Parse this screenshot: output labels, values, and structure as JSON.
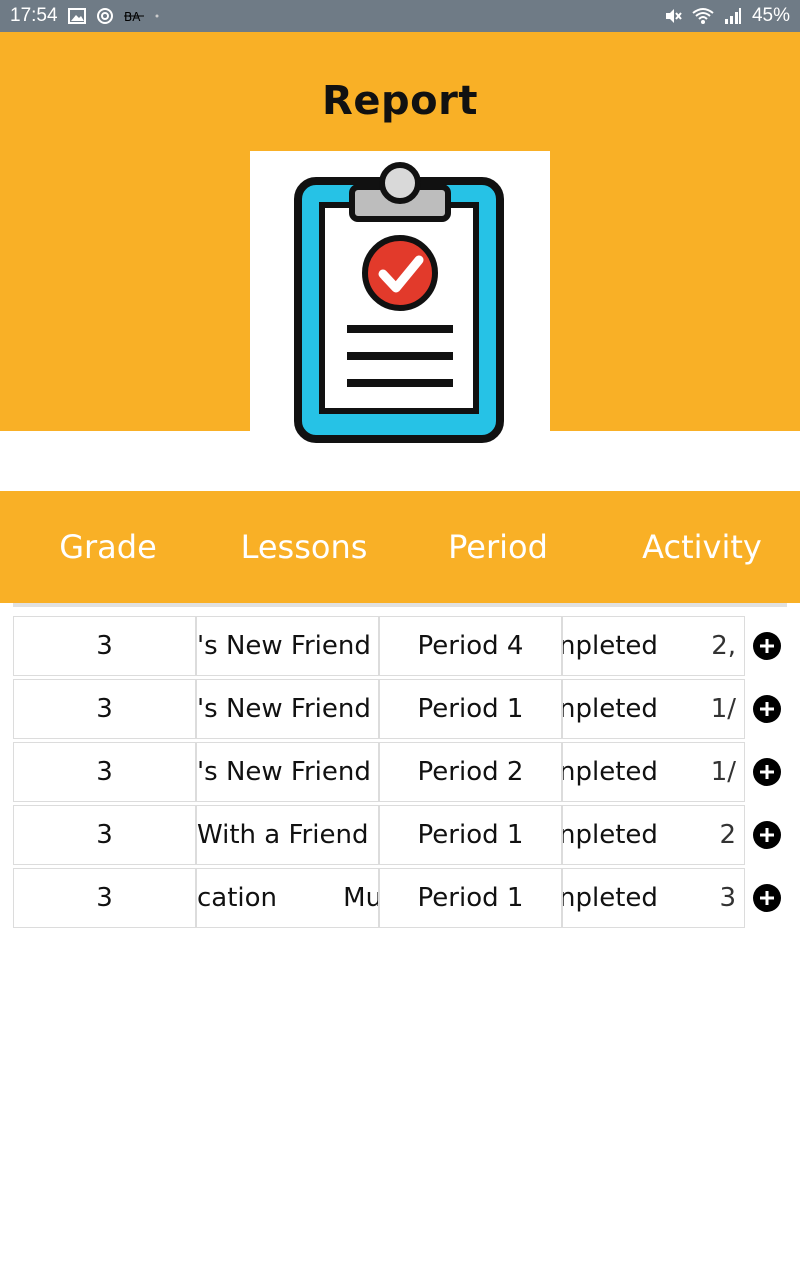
{
  "status_bar": {
    "time": "17:54",
    "battery": "45%",
    "left_icons": [
      "image-icon",
      "sync-icon",
      "notification-icon",
      "dot-icon"
    ],
    "right_icons": [
      "mute-icon",
      "wifi-icon",
      "signal-icon"
    ]
  },
  "header": {
    "title": "Report",
    "logo": "clipboard-check-icon",
    "background_color": "#f9b026"
  },
  "table": {
    "columns": [
      "Grade",
      "Lessons",
      "Period",
      "Activity"
    ],
    "rows": [
      {
        "grade": "3",
        "lesson": "'s New Friend",
        "period": "Period 4",
        "activity": "npleted",
        "date": "2,"
      },
      {
        "grade": "3",
        "lesson": "'s New Friend",
        "period": "Period 1",
        "activity": "npleted",
        "date": "1/"
      },
      {
        "grade": "3",
        "lesson": "'s New Friend",
        "period": "Period 2",
        "activity": "npleted",
        "date": "1/"
      },
      {
        "grade": "3",
        "lesson": "With a Friend",
        "period": "Period 1",
        "activity": "npleted",
        "date": "2"
      },
      {
        "grade": "3",
        "lesson": "cation        Mu",
        "period": "Period 1",
        "activity": "npleted",
        "date": "3"
      }
    ],
    "row_action_icon": "plus-circle-icon"
  }
}
